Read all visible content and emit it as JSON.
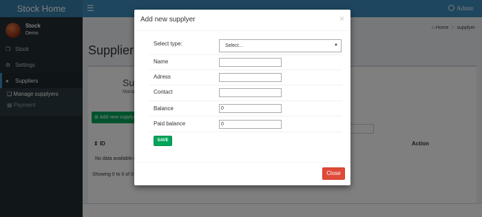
{
  "app": {
    "title": "Stock Home",
    "menu_icon": "hamburger-icon",
    "admin_label": "Admin"
  },
  "user": {
    "name": "Stock",
    "role": "Demo"
  },
  "sidebar": {
    "items": [
      {
        "label": "Stock",
        "icon": "cubes-icon"
      },
      {
        "label": "Settings",
        "icon": "cogs-icon"
      },
      {
        "label": "Suppliers",
        "icon": "fire-icon"
      }
    ],
    "submenu": [
      {
        "label": "Manage supplyers",
        "icon": "copy-icon"
      },
      {
        "label": "Payment",
        "icon": "money-icon"
      }
    ]
  },
  "breadcrumb": {
    "home": "Home",
    "current": "supplyer"
  },
  "page": {
    "title": "Supplier",
    "subtitle": "M",
    "box_title": "Supp",
    "box_subtitle": "Manage",
    "add_button": "Add new supplye",
    "table": {
      "col_id": "ID",
      "col_action": "Action"
    },
    "no_data": "No data available in",
    "showing": "Showing 0 to 0 of 0 en"
  },
  "modal": {
    "title": "Add new supplyer",
    "close_x": "×",
    "fields": [
      {
        "label": "Select type:",
        "value": "Select..."
      },
      {
        "label": "Name",
        "value": ""
      },
      {
        "label": "Adress",
        "value": ""
      },
      {
        "label": "Contact",
        "value": ""
      },
      {
        "label": "Balance",
        "value": "0"
      },
      {
        "label": "Paid balance",
        "value": "0"
      }
    ],
    "save_label": "SAVE",
    "close_label": "Close"
  },
  "colors": {
    "header": "#3c8dbc",
    "sidebar": "#222d32",
    "save": "#00a65a",
    "close": "#dd4b39"
  }
}
